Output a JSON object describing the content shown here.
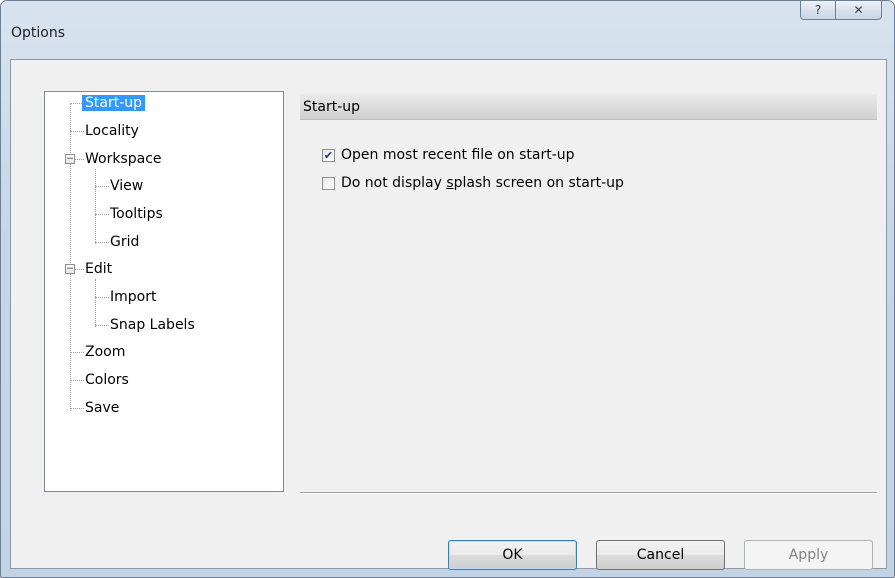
{
  "window": {
    "title": "Options"
  },
  "caption": {
    "help_glyph": "?",
    "close_glyph": "✕"
  },
  "tree": {
    "items": [
      {
        "label": "Start-up",
        "selected": true
      },
      {
        "label": "Locality"
      },
      {
        "label": "Workspace",
        "expander": "⊟"
      },
      {
        "label": "View"
      },
      {
        "label": "Tooltips"
      },
      {
        "label": "Grid"
      },
      {
        "label": "Edit",
        "expander": "⊟"
      },
      {
        "label": "Import"
      },
      {
        "label": "Snap Labels"
      },
      {
        "label": "Zoom"
      },
      {
        "label": "Colors"
      },
      {
        "label": "Save"
      }
    ]
  },
  "panel": {
    "header": "Start-up",
    "options": [
      {
        "label": "Open most recent file on start-up",
        "checked": true
      },
      {
        "label_pre": "Do not display ",
        "label_accel": "s",
        "label_post": "plash screen on start-up",
        "checked": false
      }
    ]
  },
  "buttons": {
    "ok": "OK",
    "cancel": "Cancel",
    "apply": "Apply"
  },
  "colors": {
    "selection": "#3399ff",
    "header_bg": "#dadada"
  }
}
